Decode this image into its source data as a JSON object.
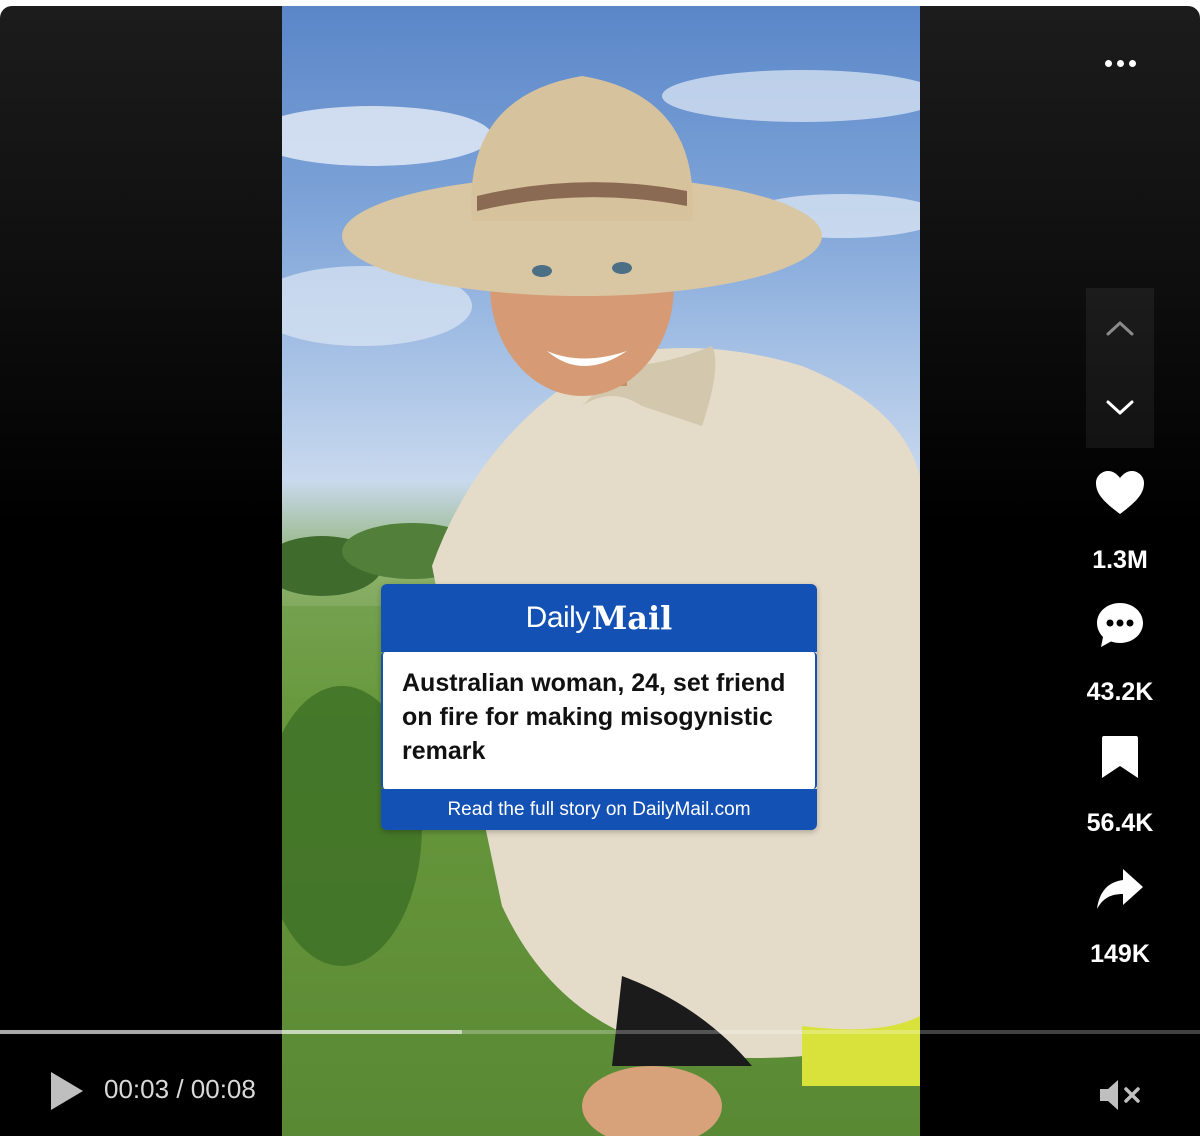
{
  "video": {
    "overlay_card": {
      "brand_part1": "Daily",
      "brand_part2": "Mail",
      "headline": "Australian woman, 24, set friend on fire for making misogynistic remark",
      "footer": "Read the full story on DailyMail.com",
      "brand_color": "#1351b4"
    }
  },
  "actions": {
    "more_icon": "ellipsis-icon",
    "prev_icon": "chevron-up-icon",
    "next_icon": "chevron-down-icon",
    "like": {
      "icon": "heart-icon",
      "count": "1.3M"
    },
    "comment": {
      "icon": "comment-icon",
      "count": "43.2K"
    },
    "save": {
      "icon": "bookmark-icon",
      "count": "56.4K"
    },
    "share": {
      "icon": "share-icon",
      "count": "149K"
    }
  },
  "controls": {
    "play_icon": "play-icon",
    "current_time": "00:03",
    "separator": "/",
    "duration": "00:08",
    "progress": 0.385,
    "mute_icon": "muted-speaker-icon"
  }
}
